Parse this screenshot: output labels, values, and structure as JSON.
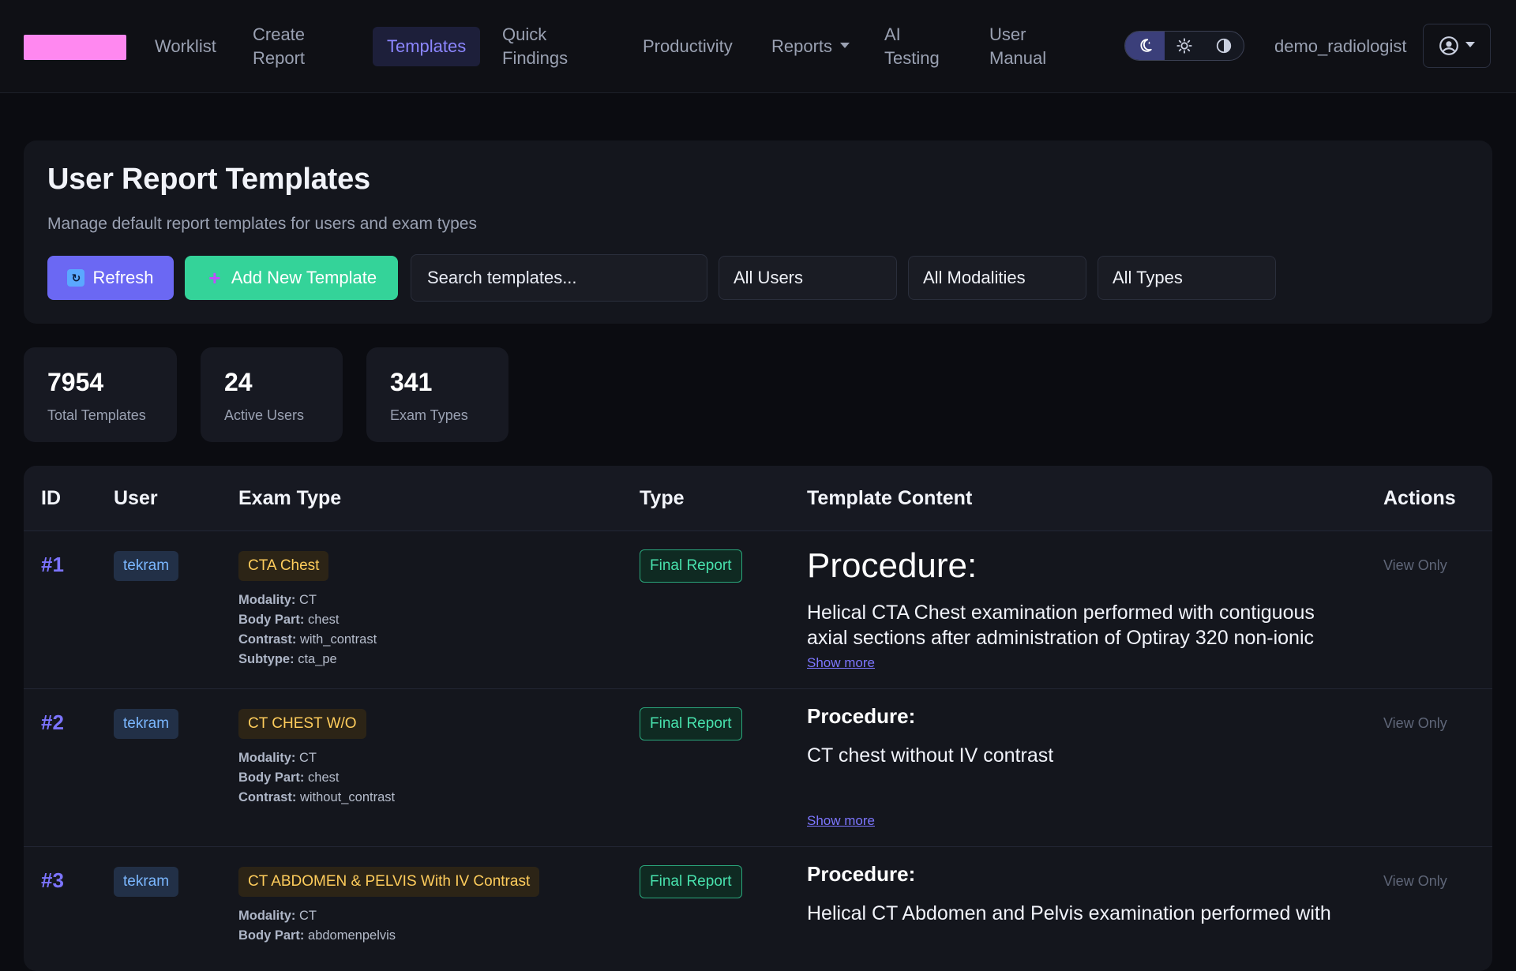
{
  "nav": {
    "items": [
      {
        "label": "Worklist"
      },
      {
        "label": "Create\nReport"
      },
      {
        "label": "Templates"
      },
      {
        "label": "Quick\nFindings"
      },
      {
        "label": "Productivity"
      },
      {
        "label": "Reports"
      },
      {
        "label": "AI\nTesting"
      },
      {
        "label": "User\nManual"
      }
    ],
    "username": "demo_radiologist"
  },
  "header": {
    "title": "User Report Templates",
    "subtitle": "Manage default report templates for users and exam types",
    "refresh_label": "Refresh",
    "add_label": "Add New Template",
    "search_placeholder": "Search templates...",
    "filters": {
      "users": "All Users",
      "modalities": "All Modalities",
      "types": "All Types"
    }
  },
  "stats": [
    {
      "value": "7954",
      "label": "Total Templates"
    },
    {
      "value": "24",
      "label": "Active Users"
    },
    {
      "value": "341",
      "label": "Exam Types"
    }
  ],
  "table": {
    "columns": [
      "ID",
      "User",
      "Exam Type",
      "Type",
      "Template Content",
      "Actions"
    ],
    "rows": [
      {
        "id": "#1",
        "user": "tekram",
        "exam": "CTA Chest",
        "meta": {
          "modality_label": "Modality:",
          "modality": "CT",
          "bodypart_label": "Body Part:",
          "bodypart": "chest",
          "contrast_label": "Contrast:",
          "contrast": "with_contrast",
          "subtype_label": "Subtype:",
          "subtype": "cta_pe"
        },
        "type": "Final Report",
        "content_heading": "Procedure:",
        "content_text": "Helical CTA Chest examination performed with contiguous axial sections after administration of Optiray 320 non-ionic",
        "show_more": "Show more",
        "action": "View Only"
      },
      {
        "id": "#2",
        "user": "tekram",
        "exam": "CT CHEST W/O",
        "meta": {
          "modality_label": "Modality:",
          "modality": "CT",
          "bodypart_label": "Body Part:",
          "bodypart": "chest",
          "contrast_label": "Contrast:",
          "contrast": "without_contrast"
        },
        "type": "Final Report",
        "content_heading": "Procedure:",
        "content_text": "CT chest without IV contrast",
        "show_more": "Show more",
        "action": "View Only"
      },
      {
        "id": "#3",
        "user": "tekram",
        "exam": "CT ABDOMEN & PELVIS With IV Contrast",
        "meta": {
          "modality_label": "Modality:",
          "modality": "CT",
          "bodypart_label": "Body Part:",
          "bodypart": "abdomenpelvis"
        },
        "type": "Final Report",
        "content_heading": "Procedure:",
        "content_text": "Helical CT Abdomen and Pelvis examination performed with",
        "action": "View Only"
      }
    ]
  },
  "colors": {
    "accent": "#6b68f3",
    "add": "#34d399",
    "link": "#7d76ff",
    "badge_exam": "#ffcd5c",
    "badge_user": "#7bb7ff",
    "badge_type": "#48e1ad"
  },
  "icons": {
    "brand": "brand-logo",
    "theme_dark": "moon-stars-icon",
    "theme_light": "sun-icon",
    "theme_contrast": "contrast-icon",
    "user": "user-circle-icon",
    "refresh": "refresh-icon",
    "add": "plus-icon"
  }
}
